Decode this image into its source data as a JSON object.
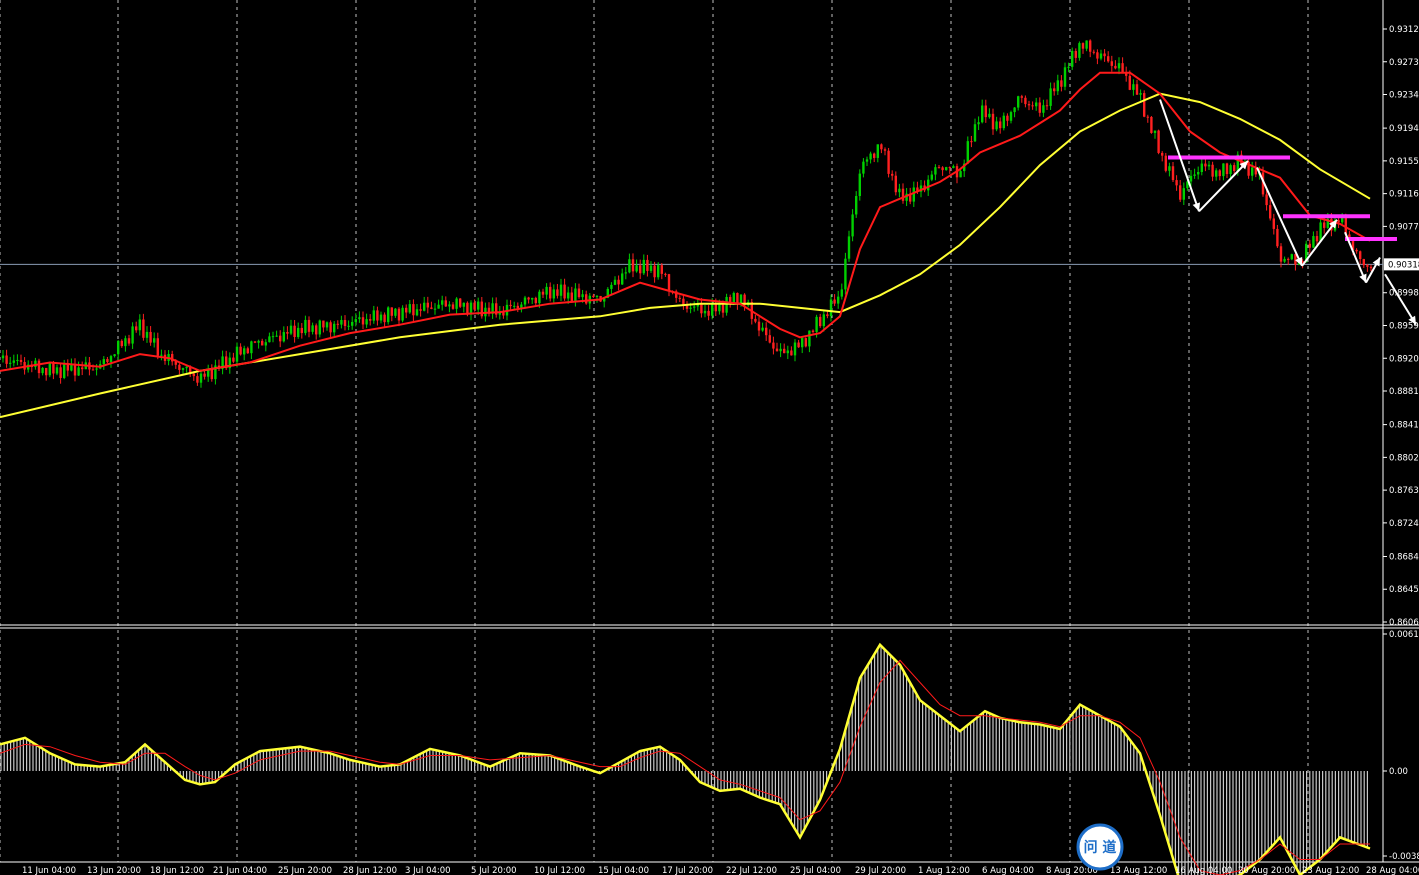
{
  "chart_data": [
    {
      "type": "candlestick",
      "panel": "price",
      "y_ticks": [
        "0.93120",
        "0.92730",
        "0.92340",
        "0.91940",
        "0.91550",
        "0.91160",
        "0.90770",
        "0.90318",
        "0.89980",
        "0.89590",
        "0.89200",
        "0.88810",
        "0.88410",
        "0.88020",
        "0.87630",
        "0.87240",
        "0.86840",
        "0.86450",
        "0.86060"
      ],
      "current_price": "0.90318",
      "ylim": [
        0.8606,
        0.9332
      ],
      "grid": "vertical dashed",
      "colors": {
        "bull": "#00d000",
        "bear": "#ff2020",
        "ma_fast": "#ff1a1a",
        "ma_slow": "#ffff33",
        "levels": "#ff33ff",
        "arrows": "#ffffff"
      },
      "series": [
        {
          "name": "close",
          "x": [
            0,
            50,
            100,
            140,
            160,
            200,
            250,
            300,
            340,
            400,
            450,
            500,
            550,
            600,
            630,
            660,
            680,
            710,
            740,
            760,
            780,
            800,
            820,
            840,
            860,
            880,
            900,
            920,
            940,
            960,
            980,
            1000,
            1020,
            1040,
            1060,
            1080,
            1100,
            1120,
            1140,
            1160,
            1180,
            1200,
            1220,
            1240,
            1260,
            1280,
            1300,
            1320,
            1340,
            1360,
            1370
          ],
          "values": [
            0.892,
            0.8905,
            0.891,
            0.896,
            0.8925,
            0.8895,
            0.8935,
            0.8955,
            0.896,
            0.8975,
            0.8985,
            0.8975,
            0.9,
            0.899,
            0.903,
            0.9025,
            0.8985,
            0.8975,
            0.8995,
            0.8955,
            0.8925,
            0.8935,
            0.8965,
            0.8995,
            0.9145,
            0.9175,
            0.911,
            0.912,
            0.915,
            0.914,
            0.9215,
            0.9195,
            0.923,
            0.9215,
            0.925,
            0.9295,
            0.928,
            0.9265,
            0.923,
            0.9165,
            0.9115,
            0.915,
            0.914,
            0.9155,
            0.9135,
            0.904,
            0.9035,
            0.9075,
            0.9085,
            0.9035,
            0.903
          ]
        },
        {
          "name": "ma_fast",
          "x": [
            0,
            50,
            100,
            140,
            170,
            200,
            250,
            300,
            350,
            400,
            450,
            500,
            550,
            600,
            640,
            670,
            700,
            740,
            780,
            800,
            820,
            840,
            860,
            880,
            900,
            920,
            940,
            960,
            980,
            1000,
            1020,
            1040,
            1060,
            1080,
            1100,
            1130,
            1160,
            1190,
            1220,
            1250,
            1280,
            1310,
            1340,
            1370
          ],
          "values": [
            0.8905,
            0.8915,
            0.891,
            0.8925,
            0.892,
            0.8905,
            0.8915,
            0.8935,
            0.895,
            0.896,
            0.8972,
            0.8975,
            0.8985,
            0.899,
            0.901,
            0.9,
            0.899,
            0.8985,
            0.8955,
            0.8945,
            0.895,
            0.897,
            0.905,
            0.91,
            0.911,
            0.912,
            0.913,
            0.9145,
            0.9165,
            0.9175,
            0.9185,
            0.92,
            0.9215,
            0.924,
            0.926,
            0.926,
            0.9235,
            0.919,
            0.9165,
            0.915,
            0.9135,
            0.909,
            0.908,
            0.906
          ]
        },
        {
          "name": "ma_slow",
          "x": [
            0,
            100,
            200,
            300,
            400,
            500,
            600,
            650,
            700,
            760,
            800,
            840,
            880,
            920,
            960,
            1000,
            1040,
            1080,
            1120,
            1160,
            1200,
            1240,
            1280,
            1320,
            1370
          ],
          "values": [
            0.885,
            0.8878,
            0.8905,
            0.8925,
            0.8945,
            0.896,
            0.897,
            0.898,
            0.8985,
            0.8985,
            0.898,
            0.8975,
            0.8995,
            0.902,
            0.9055,
            0.91,
            0.915,
            0.919,
            0.9215,
            0.9235,
            0.9225,
            0.9205,
            0.918,
            0.9145,
            0.911
          ]
        }
      ],
      "levels": [
        {
          "value": 0.9159,
          "x_from": 1168,
          "x_to": 1290
        },
        {
          "value": 0.9089,
          "x_from": 1283,
          "x_to": 1370
        },
        {
          "value": 0.9062,
          "x_from": 1345,
          "x_to": 1397
        }
      ],
      "arrows": [
        {
          "from": [
            1160,
            0.9228
          ],
          "to": [
            1199,
            0.9095
          ]
        },
        {
          "from": [
            1199,
            0.9095
          ],
          "to": [
            1248,
            0.9155
          ]
        },
        {
          "from": [
            1257,
            0.9147
          ],
          "to": [
            1302,
            0.903
          ]
        },
        {
          "from": [
            1302,
            0.903
          ],
          "to": [
            1337,
            0.9085
          ]
        },
        {
          "from": [
            1345,
            0.907
          ],
          "to": [
            1366,
            0.901
          ]
        },
        {
          "from": [
            1366,
            0.901
          ],
          "to": [
            1380,
            0.904
          ]
        },
        {
          "from": [
            1385,
            0.902
          ],
          "to": [
            1416,
            0.896
          ]
        }
      ]
    },
    {
      "type": "bar",
      "panel": "oscillator",
      "y_ticks": [
        "0.00619",
        "0.00",
        "-0.00384"
      ],
      "ylim": [
        -0.00384,
        0.00619
      ],
      "colors": {
        "histogram": "#c8c8c8",
        "line": "#ffff33",
        "signal": "#ff1a1a"
      },
      "series": [
        {
          "name": "histogram",
          "x": [
            0,
            25,
            50,
            75,
            100,
            125,
            145,
            165,
            185,
            200,
            215,
            235,
            260,
            300,
            330,
            350,
            380,
            400,
            430,
            460,
            490,
            520,
            550,
            580,
            600,
            620,
            640,
            660,
            680,
            700,
            720,
            740,
            760,
            780,
            800,
            820,
            840,
            860,
            880,
            900,
            920,
            940,
            960,
            985,
            1000,
            1020,
            1040,
            1060,
            1080,
            1100,
            1120,
            1140,
            1160,
            1180,
            1200,
            1220,
            1240,
            1260,
            1280,
            1300,
            1320,
            1340,
            1370
          ],
          "values": [
            0.0012,
            0.0015,
            0.0008,
            0.0003,
            0.0002,
            0.0004,
            0.0012,
            0.0004,
            -0.0004,
            -0.0006,
            -0.0005,
            0.0003,
            0.0009,
            0.0011,
            0.0008,
            0.0005,
            0.0002,
            0.0003,
            0.001,
            0.0007,
            0.0002,
            0.0008,
            0.0007,
            0.0002,
            -0.0001,
            0.0004,
            0.0009,
            0.0011,
            0.0005,
            -0.0005,
            -0.0009,
            -0.0008,
            -0.0012,
            -0.0015,
            -0.003,
            -0.0013,
            0.001,
            0.0042,
            0.0057,
            0.0048,
            0.0032,
            0.0025,
            0.0018,
            0.0027,
            0.0024,
            0.0022,
            0.0021,
            0.0019,
            0.003,
            0.0025,
            0.002,
            0.0008,
            -0.002,
            -0.005,
            -0.0055,
            -0.005,
            -0.0047,
            -0.004,
            -0.003,
            -0.0047,
            -0.004,
            -0.003,
            -0.0035
          ]
        },
        {
          "name": "signal",
          "x": [
            0,
            25,
            50,
            75,
            100,
            125,
            145,
            165,
            185,
            200,
            215,
            235,
            260,
            300,
            330,
            350,
            380,
            400,
            430,
            460,
            490,
            520,
            550,
            580,
            600,
            620,
            640,
            660,
            680,
            700,
            720,
            740,
            760,
            780,
            800,
            820,
            840,
            860,
            880,
            900,
            920,
            940,
            960,
            985,
            1000,
            1020,
            1040,
            1060,
            1080,
            1100,
            1120,
            1140,
            1160,
            1180,
            1200,
            1220,
            1240,
            1260,
            1280,
            1300,
            1320,
            1340,
            1370
          ],
          "values": [
            0.0008,
            0.0012,
            0.0011,
            0.0007,
            0.0004,
            0.0003,
            0.0008,
            0.0008,
            0.0002,
            -0.0002,
            -0.0004,
            -0.0001,
            0.0005,
            0.0009,
            0.0009,
            0.0007,
            0.0004,
            0.0003,
            0.0007,
            0.0007,
            0.0005,
            0.0006,
            0.0007,
            0.0004,
            0.0002,
            0.0002,
            0.0006,
            0.0009,
            0.0008,
            0.0002,
            -0.0004,
            -0.0006,
            -0.0009,
            -0.0012,
            -0.0022,
            -0.0018,
            -0.0005,
            0.002,
            0.004,
            0.005,
            0.004,
            0.003,
            0.0025,
            0.0025,
            0.0024,
            0.0023,
            0.0022,
            0.002,
            0.0025,
            0.0025,
            0.0022,
            0.0015,
            -0.0005,
            -0.003,
            -0.0045,
            -0.0047,
            -0.0045,
            -0.004,
            -0.0033,
            -0.004,
            -0.004,
            -0.0033,
            -0.0033
          ]
        }
      ],
      "x_labels": [
        "11 Jun 04:00",
        "13 Jun 20:00",
        "18 Jun 12:00",
        "21 Jun 04:00",
        "25 Jun 20:00",
        "28 Jun 12:00",
        "3 Jul 04:00",
        "5 Jul 20:00",
        "10 Jul 12:00",
        "15 Jul 04:00",
        "17 Jul 20:00",
        "22 Jul 12:00",
        "25 Jul 04:00",
        "29 Jul 20:00",
        "1 Aug 12:00",
        "6 Aug 04:00",
        "8 Aug 20:00",
        "13 Aug 12:00",
        "16 Aug 04:00",
        "20 Aug 20:00",
        "23 Aug 12:00",
        "28 Aug 04:00"
      ]
    }
  ],
  "watermark": {
    "text": "问 道"
  }
}
